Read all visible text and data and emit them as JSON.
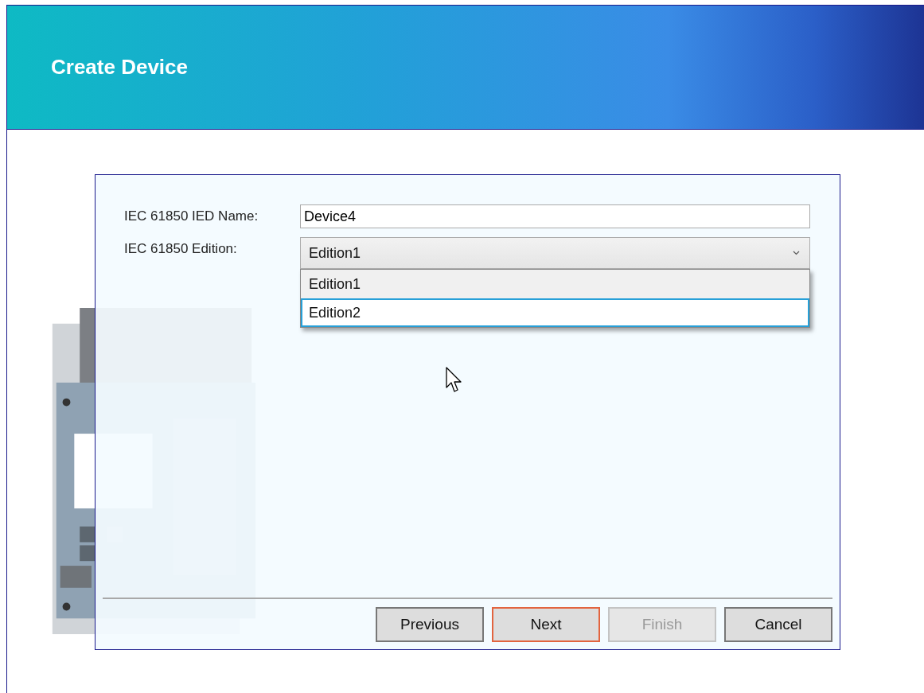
{
  "header": {
    "title": "Create Device"
  },
  "form": {
    "fields": [
      {
        "kind": "text",
        "label": "IEC 61850 IED Name:",
        "value": "Device4"
      },
      {
        "kind": "combo",
        "label": "IEC 61850 Edition:",
        "value": "Edition1",
        "expanded": true,
        "options": [
          {
            "label": "Edition1",
            "selected": true,
            "focused": false
          },
          {
            "label": "Edition2",
            "selected": false,
            "focused": true
          }
        ]
      }
    ]
  },
  "buttons": [
    {
      "label": "Previous",
      "default": false,
      "disabled": false
    },
    {
      "label": "Next",
      "default": true,
      "disabled": false
    },
    {
      "label": "Finish",
      "default": false,
      "disabled": true
    },
    {
      "label": "Cancel",
      "default": false,
      "disabled": false
    }
  ]
}
